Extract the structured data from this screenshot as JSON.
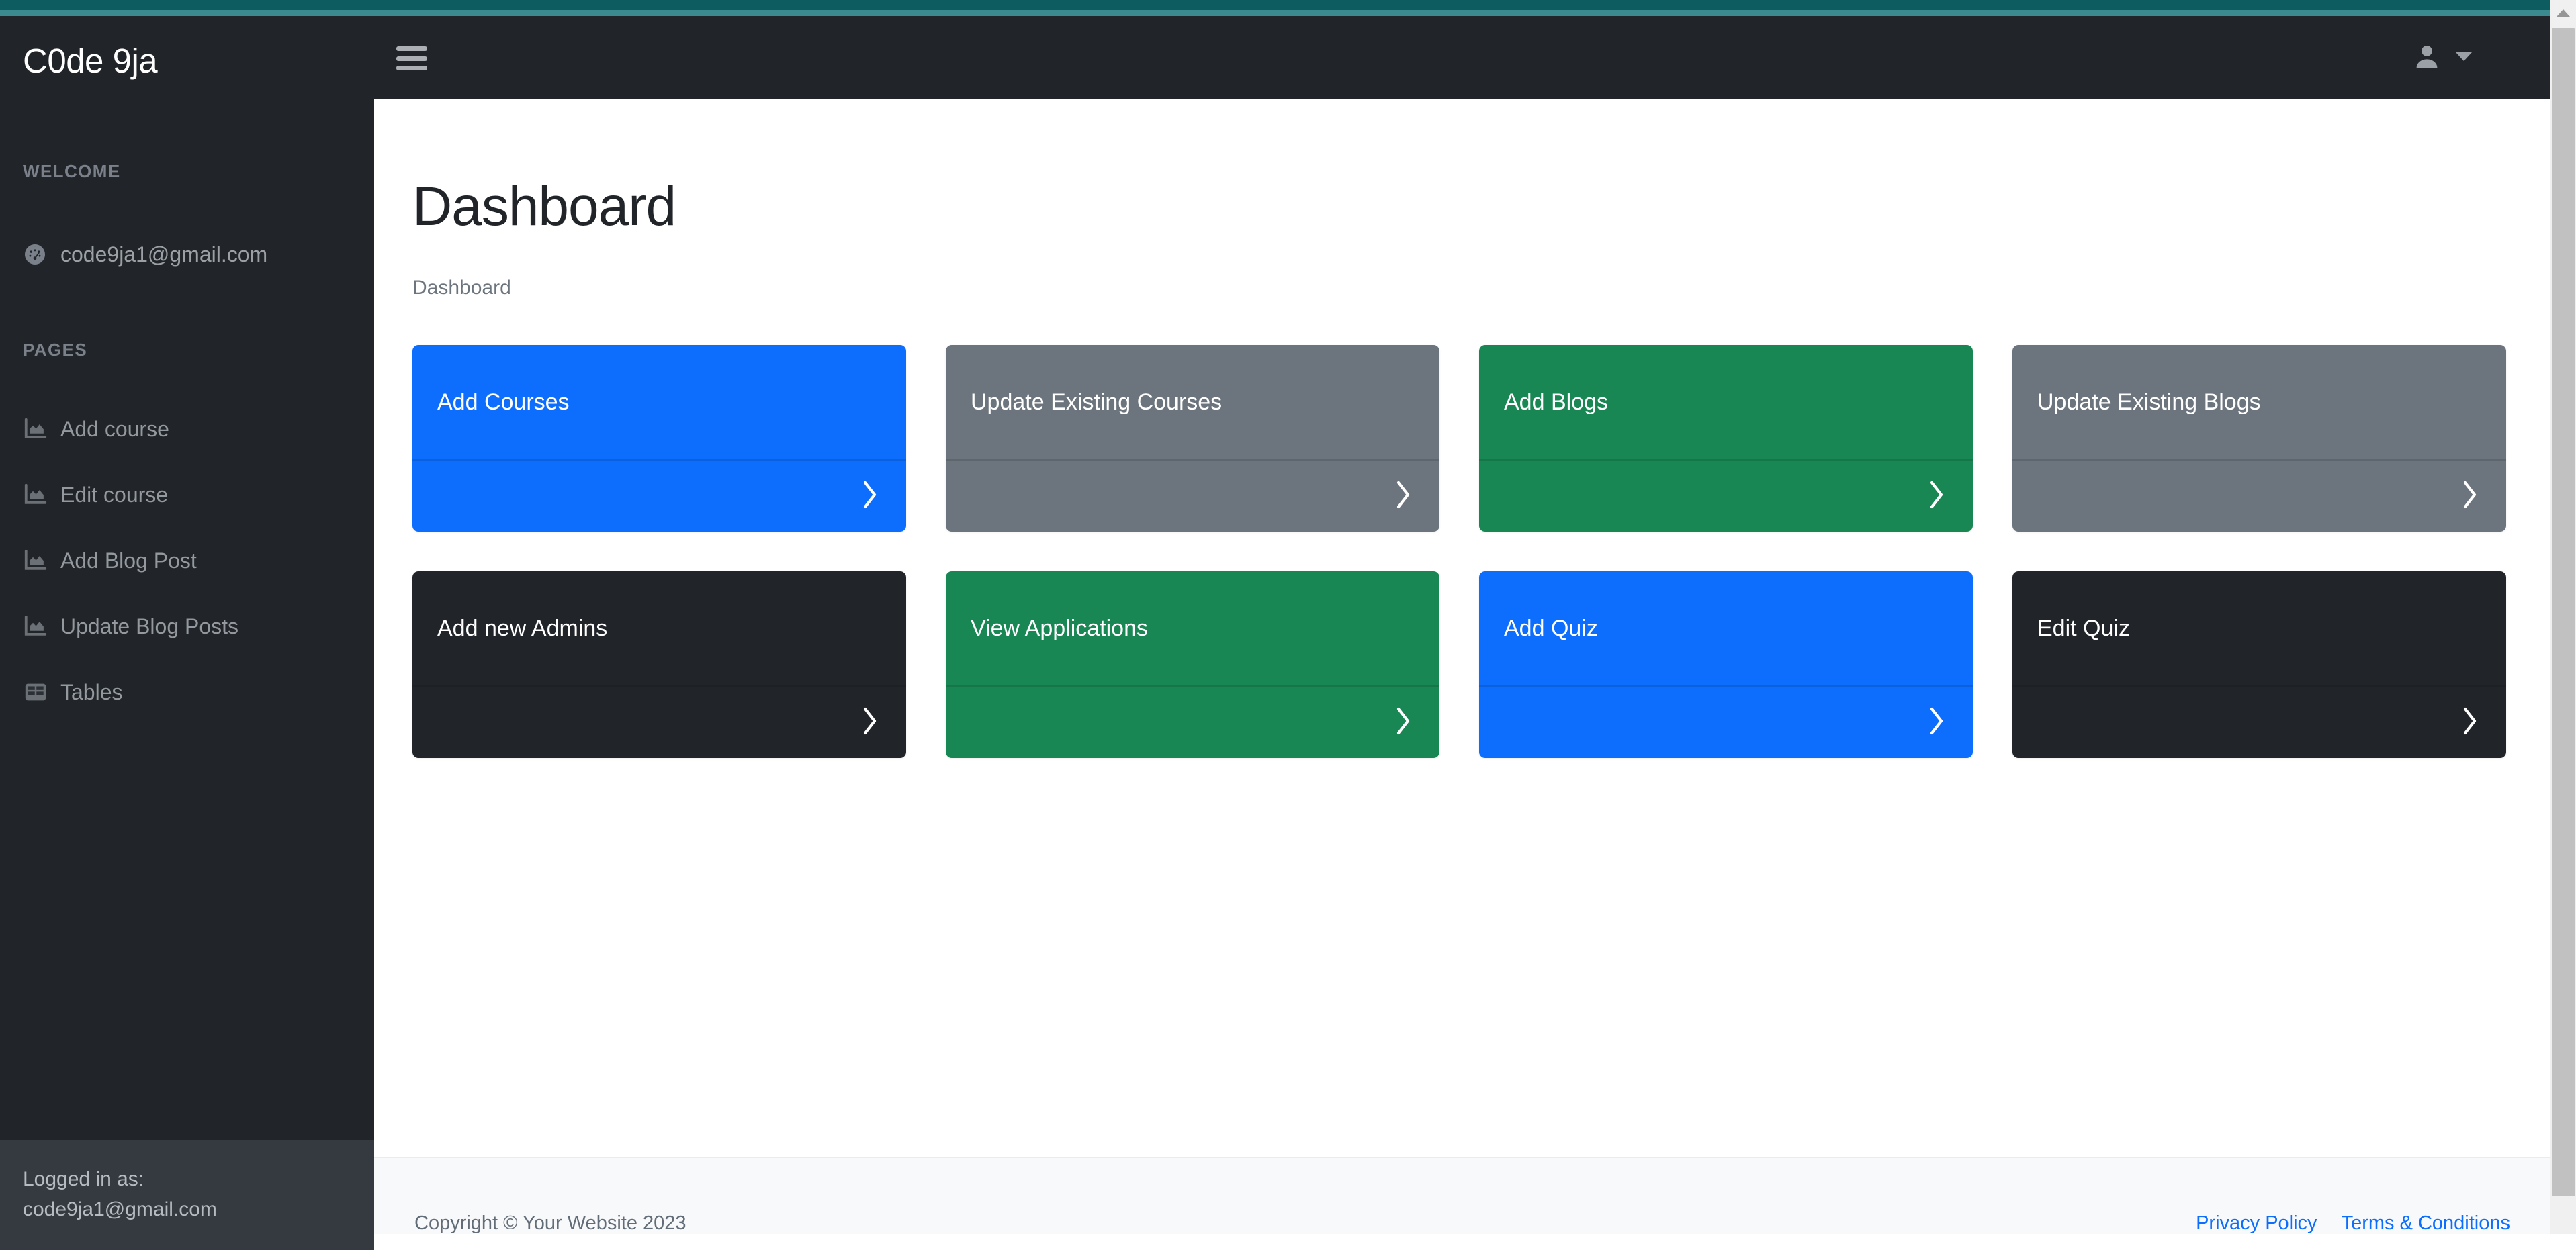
{
  "theme": {
    "accent_dark_teal": "#0c5c60",
    "accent_light_teal": "#3a8a90",
    "sidebar_bg": "#212529",
    "sidebar_footer_bg": "#343a40",
    "primary_blue": "#0d6efd",
    "success_green": "#198754",
    "secondary_gray": "#6c757d",
    "dark": "#212529",
    "footer_bg": "#f8f9fa"
  },
  "sidebar": {
    "brand": "C0de 9ja",
    "welcome_heading": "WELCOME",
    "pages_heading": "PAGES",
    "user_email": "code9ja1@gmail.com",
    "user_email_icon": "tachometer-dashboard-icon",
    "items": [
      {
        "label": "Add course",
        "icon": "area-chart-icon"
      },
      {
        "label": "Edit course",
        "icon": "area-chart-icon"
      },
      {
        "label": "Add Blog Post",
        "icon": "area-chart-icon"
      },
      {
        "label": "Update Blog Posts",
        "icon": "area-chart-icon"
      },
      {
        "label": "Tables",
        "icon": "table-icon"
      }
    ],
    "footer": {
      "label": "Logged in as:",
      "email": "code9ja1@gmail.com"
    }
  },
  "header": {
    "menu_toggle_icon": "hamburger-menu-icon",
    "user_icon": "user-avatar-icon",
    "caret_icon": "chevron-down-icon"
  },
  "main": {
    "title": "Dashboard",
    "breadcrumb": "Dashboard",
    "cards": [
      {
        "label": "Update Existing Courses",
        "color": "#6c757d",
        "arrow_icon": "chevron-right-icon"
      },
      {
        "label": "Add Courses",
        "color": "#0d6efd",
        "arrow_icon": "chevron-right-icon"
      },
      {
        "label": "Add Blogs",
        "color": "#198754",
        "arrow_icon": "chevron-right-icon"
      },
      {
        "label": "Update Existing Blogs",
        "color": "#6c757d",
        "arrow_icon": "chevron-right-icon"
      },
      {
        "label": "Add new Admins",
        "color": "#212529",
        "arrow_icon": "chevron-right-icon"
      },
      {
        "label": "View Applications",
        "color": "#198754",
        "arrow_icon": "chevron-right-icon"
      },
      {
        "label": "Add Quiz",
        "color": "#0d6efd",
        "arrow_icon": "chevron-right-icon"
      },
      {
        "label": "Edit Quiz",
        "color": "#212529",
        "arrow_icon": "chevron-right-icon"
      }
    ],
    "card_order": [
      1,
      0,
      2,
      3,
      4,
      5,
      6,
      7
    ]
  },
  "page_footer": {
    "copyright": "Copyright © Your Website 2023",
    "links": [
      {
        "label": "Privacy Policy"
      },
      {
        "label": "Terms & Conditions"
      }
    ]
  },
  "scrollbar": {
    "up_arrow_icon": "scroll-up-arrow-icon",
    "thumb_icon": "scrollbar-thumb"
  }
}
